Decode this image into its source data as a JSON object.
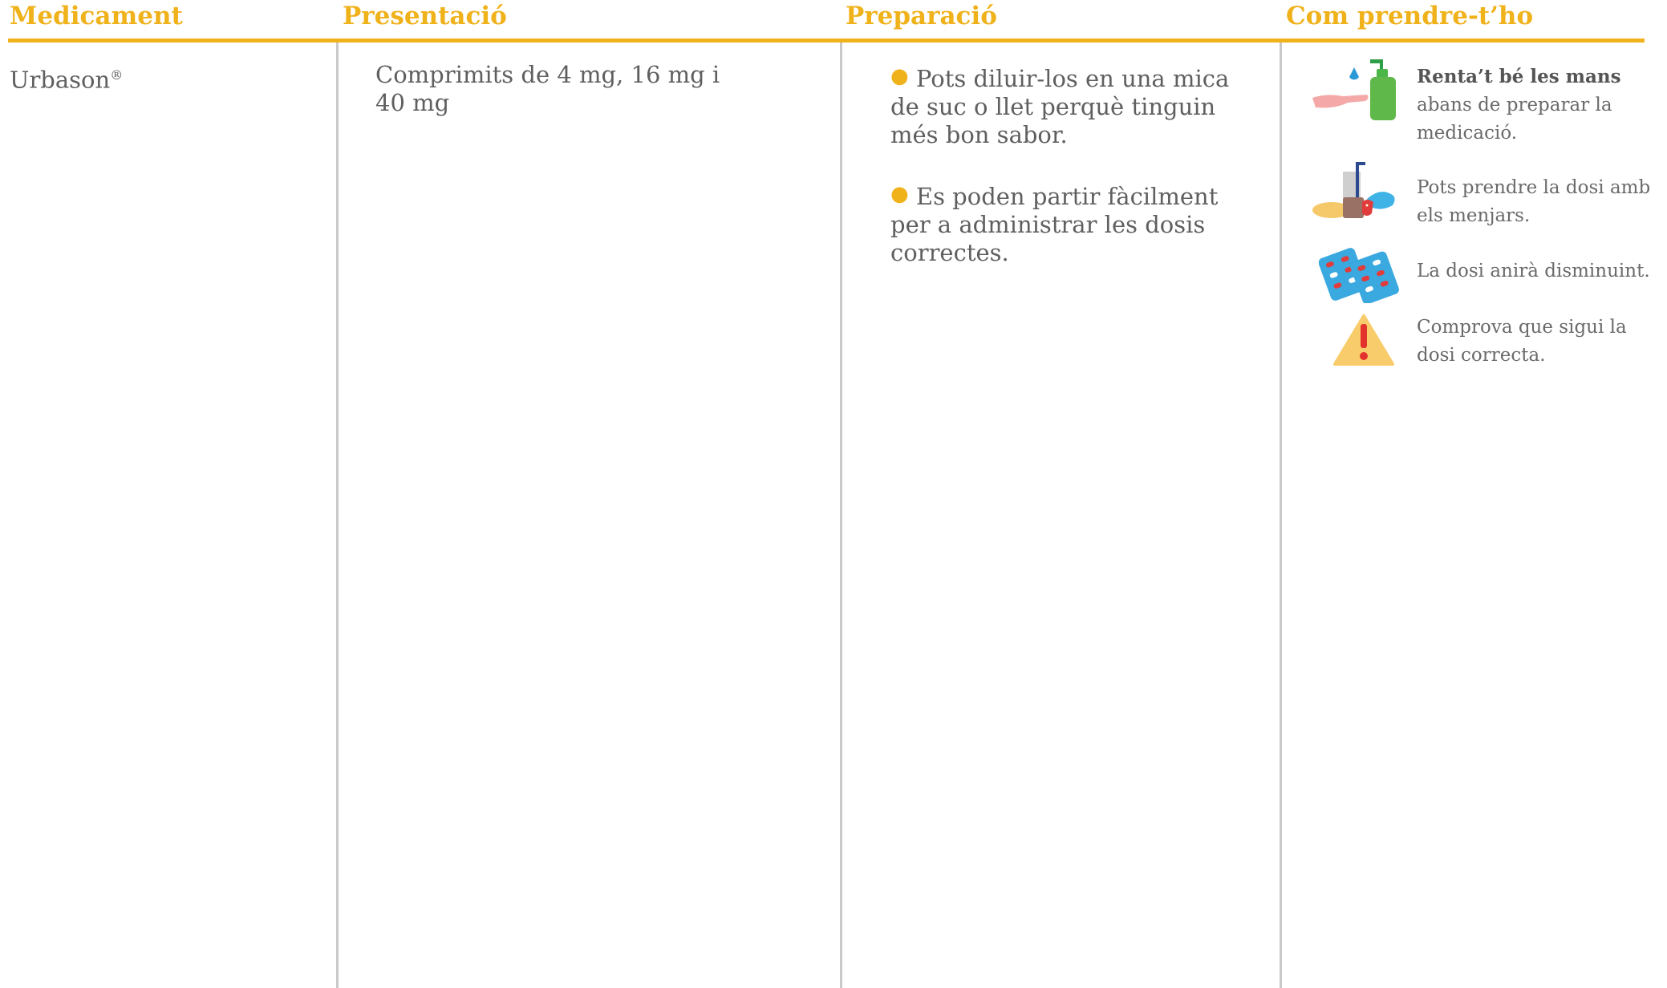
{
  "headers": {
    "medicament": "Medicament",
    "presentacio": "Presentació",
    "preparacio": "Preparació",
    "com_prendre": "Com prendre-t’ho"
  },
  "row": {
    "medicament": "Urbason",
    "medicament_mark": "®",
    "presentacio": "Comprimits de 4 mg, 16 mg i 40 mg",
    "preparacio": [
      "Pots diluir-los en una mica de suc o llet perquè tinguin més bon sabor.",
      "Es poden partir fàcilment per a administrar les dosis correctes."
    ],
    "instructions": [
      {
        "icon": "hand-wash-icon",
        "bold": "Renta’t bé les mans",
        "text": " abans de preparar la medicació."
      },
      {
        "icon": "food-icon",
        "bold": "",
        "text": "Pots prendre la dosi amb els menjars."
      },
      {
        "icon": "pill-blister-icon",
        "bold": "",
        "text": "La dosi anirà disminuint."
      },
      {
        "icon": "warning-icon",
        "bold": "",
        "text": "Comprova que sigui la dosi correcta."
      }
    ]
  },
  "colors": {
    "accent": "#f0b21b",
    "text": "#5f5f5f",
    "divider": "#c9c9c9"
  }
}
